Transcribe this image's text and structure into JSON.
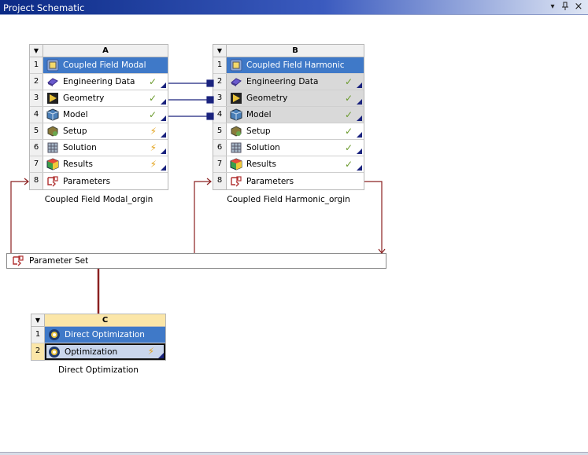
{
  "window": {
    "title": "Project Schematic",
    "buttons": [
      {
        "name": "dropdown-icon",
        "glyph": "▾"
      },
      {
        "name": "pin-icon",
        "glyph": "📌"
      },
      {
        "name": "close-icon",
        "glyph": "×"
      }
    ]
  },
  "systems": {
    "A": {
      "letter": "A",
      "caption": "Coupled Field Modal_orgin",
      "rows": [
        {
          "num": "1",
          "label": "Coupled Field Modal",
          "icon": "modal-system-icon",
          "status": ""
        },
        {
          "num": "2",
          "label": "Engineering Data",
          "icon": "engineering-data-icon",
          "status": "✓"
        },
        {
          "num": "3",
          "label": "Geometry",
          "icon": "geometry-icon",
          "status": "✓"
        },
        {
          "num": "4",
          "label": "Model",
          "icon": "model-icon",
          "status": "✓"
        },
        {
          "num": "5",
          "label": "Setup",
          "icon": "setup-icon",
          "status": "⚡"
        },
        {
          "num": "6",
          "label": "Solution",
          "icon": "solution-icon",
          "status": "⚡"
        },
        {
          "num": "7",
          "label": "Results",
          "icon": "results-icon",
          "status": "⚡"
        },
        {
          "num": "8",
          "label": "Parameters",
          "icon": "parameters-icon",
          "status": ""
        }
      ]
    },
    "B": {
      "letter": "B",
      "caption": "Coupled Field Harmonic_orgin",
      "rows": [
        {
          "num": "1",
          "label": "Coupled Field Harmonic",
          "icon": "harmonic-system-icon",
          "status": ""
        },
        {
          "num": "2",
          "label": "Engineering Data",
          "icon": "engineering-data-icon",
          "status": "✓"
        },
        {
          "num": "3",
          "label": "Geometry",
          "icon": "geometry-icon",
          "status": "✓"
        },
        {
          "num": "4",
          "label": "Model",
          "icon": "model-icon",
          "status": "✓"
        },
        {
          "num": "5",
          "label": "Setup",
          "icon": "setup-icon",
          "status": "✓"
        },
        {
          "num": "6",
          "label": "Solution",
          "icon": "solution-icon",
          "status": "✓"
        },
        {
          "num": "7",
          "label": "Results",
          "icon": "results-icon",
          "status": "✓"
        },
        {
          "num": "8",
          "label": "Parameters",
          "icon": "parameters-icon",
          "status": ""
        }
      ]
    },
    "C": {
      "letter": "C",
      "caption": "Direct Optimization",
      "rows": [
        {
          "num": "1",
          "label": "Direct Optimization",
          "icon": "direct-optimization-icon",
          "status": ""
        },
        {
          "num": "2",
          "label": "Optimization",
          "icon": "optimization-icon",
          "status": "⚡"
        }
      ]
    }
  },
  "parameter_set": {
    "label": "Parameter Set",
    "icon": "parameter-set-icon"
  },
  "colors": {
    "title_row": "#3f79c8",
    "link_line": "#1a237e",
    "param_line": "#8b2020",
    "check": "#6a9a2c",
    "bolt": "#e3a21a",
    "system_c_header": "#fbe6a8"
  }
}
